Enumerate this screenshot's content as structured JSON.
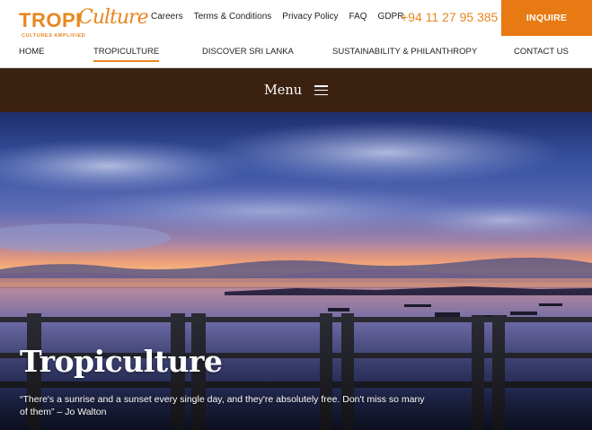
{
  "header": {
    "logo": {
      "word1": "TROPI",
      "word2": "Culture",
      "tagline": "CULTURES AMPLIFIED"
    },
    "util_links": [
      {
        "label": "Careers"
      },
      {
        "label": "Terms & Conditions"
      },
      {
        "label": "Privacy Policy"
      },
      {
        "label": "FAQ"
      },
      {
        "label": "GDPR"
      }
    ],
    "phone": "+94 11 27 95 385",
    "inquire_label": "INQUIRE",
    "accent_color": "#e8861e"
  },
  "nav": {
    "items": [
      {
        "label": "HOME"
      },
      {
        "label": "TROPICULTURE",
        "active": true
      },
      {
        "label": "DISCOVER SRI LANKA"
      },
      {
        "label": "SUSTAINABILITY & PHILANTHROPY"
      },
      {
        "label": "CONTACT US"
      }
    ]
  },
  "menubar": {
    "label": "Menu",
    "icon": "hamburger-icon",
    "bg_color": "#3b2210"
  },
  "hero": {
    "title": "Tropiculture",
    "quote": "“There's a sunrise and a sunset every single day, and they're absolutely free. Don't miss so many of them” – Jo Walton"
  }
}
